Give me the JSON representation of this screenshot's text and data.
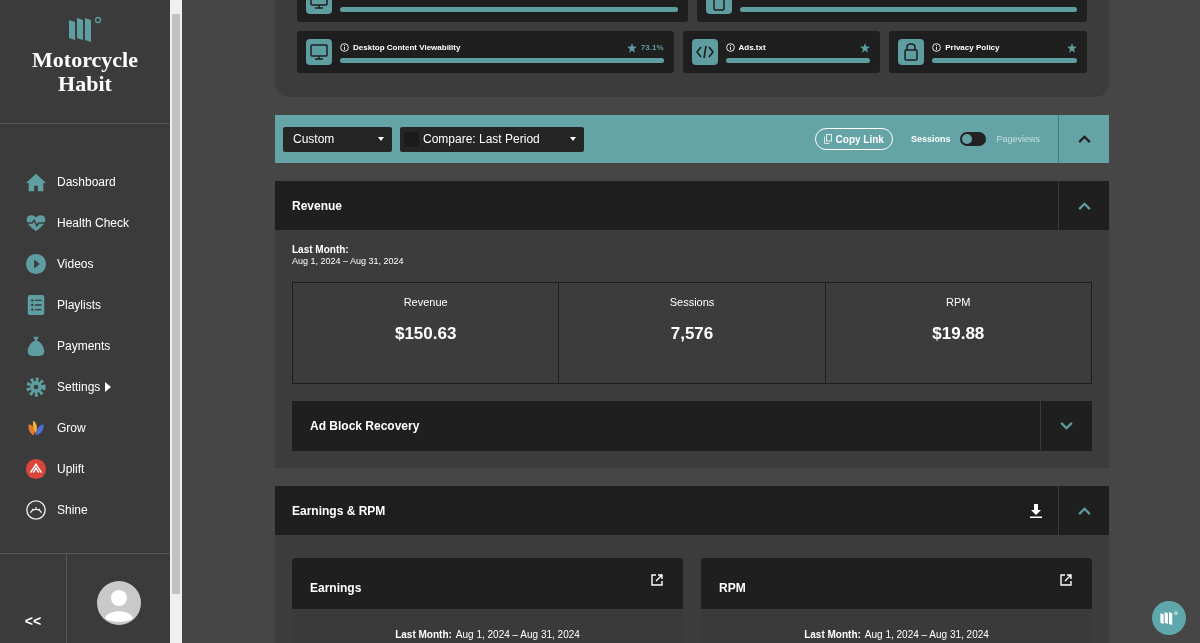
{
  "sidebar": {
    "brand": "Motorcycle Habit",
    "items": [
      {
        "label": "Dashboard",
        "kind": "home",
        "submenu": false
      },
      {
        "label": "Health Check",
        "kind": "heart",
        "submenu": false
      },
      {
        "label": "Videos",
        "kind": "play",
        "submenu": false
      },
      {
        "label": "Playlists",
        "kind": "list",
        "submenu": false
      },
      {
        "label": "Payments",
        "kind": "money",
        "submenu": false
      },
      {
        "label": "Settings",
        "kind": "gear",
        "submenu": true
      },
      {
        "label": "Grow",
        "kind": "grow",
        "submenu": false
      },
      {
        "label": "Uplift",
        "kind": "uplift",
        "submenu": false
      },
      {
        "label": "Shine",
        "kind": "shine",
        "submenu": false
      }
    ],
    "collapse": "<<"
  },
  "health_rows": [
    [
      {
        "kind": "monitor",
        "level": 1
      },
      {
        "kind": "phone",
        "level": 1
      }
    ],
    [
      {
        "kind": "monitor",
        "title": "Desktop Content Viewability",
        "score": "73.1%",
        "level": 1
      },
      {
        "kind": "code",
        "title": "Ads.txt",
        "level": 1
      },
      {
        "kind": "lock",
        "title": "Privacy Policy",
        "level": 1
      }
    ]
  ],
  "toolbar": {
    "range": "Custom",
    "compare": "Compare: Last Period",
    "compare_checked": false,
    "copy_link": "Copy Link",
    "toggle_left": "Sessions",
    "toggle_right": "Pageviews",
    "toggle_on": false
  },
  "revenue": {
    "title": "Revenue",
    "expanded": true,
    "period_label": "Last Month:",
    "period": "Aug 1, 2024 – Aug 31, 2024",
    "metrics": [
      {
        "label": "Revenue",
        "value": "$150.63"
      },
      {
        "label": "Sessions",
        "value": "7,576"
      },
      {
        "label": "RPM",
        "value": "$19.88"
      }
    ],
    "sub": {
      "title": "Ad Block Recovery",
      "expanded": false
    }
  },
  "earnings": {
    "title": "Earnings & RPM",
    "expanded": true,
    "cards": [
      {
        "title": "Earnings",
        "period_label": "Last Month:",
        "period": "Aug 1, 2024 – Aug 31, 2024"
      },
      {
        "title": "RPM",
        "period_label": "Last Month:",
        "period": "Aug 1, 2024 – Aug 31, 2024"
      }
    ]
  }
}
